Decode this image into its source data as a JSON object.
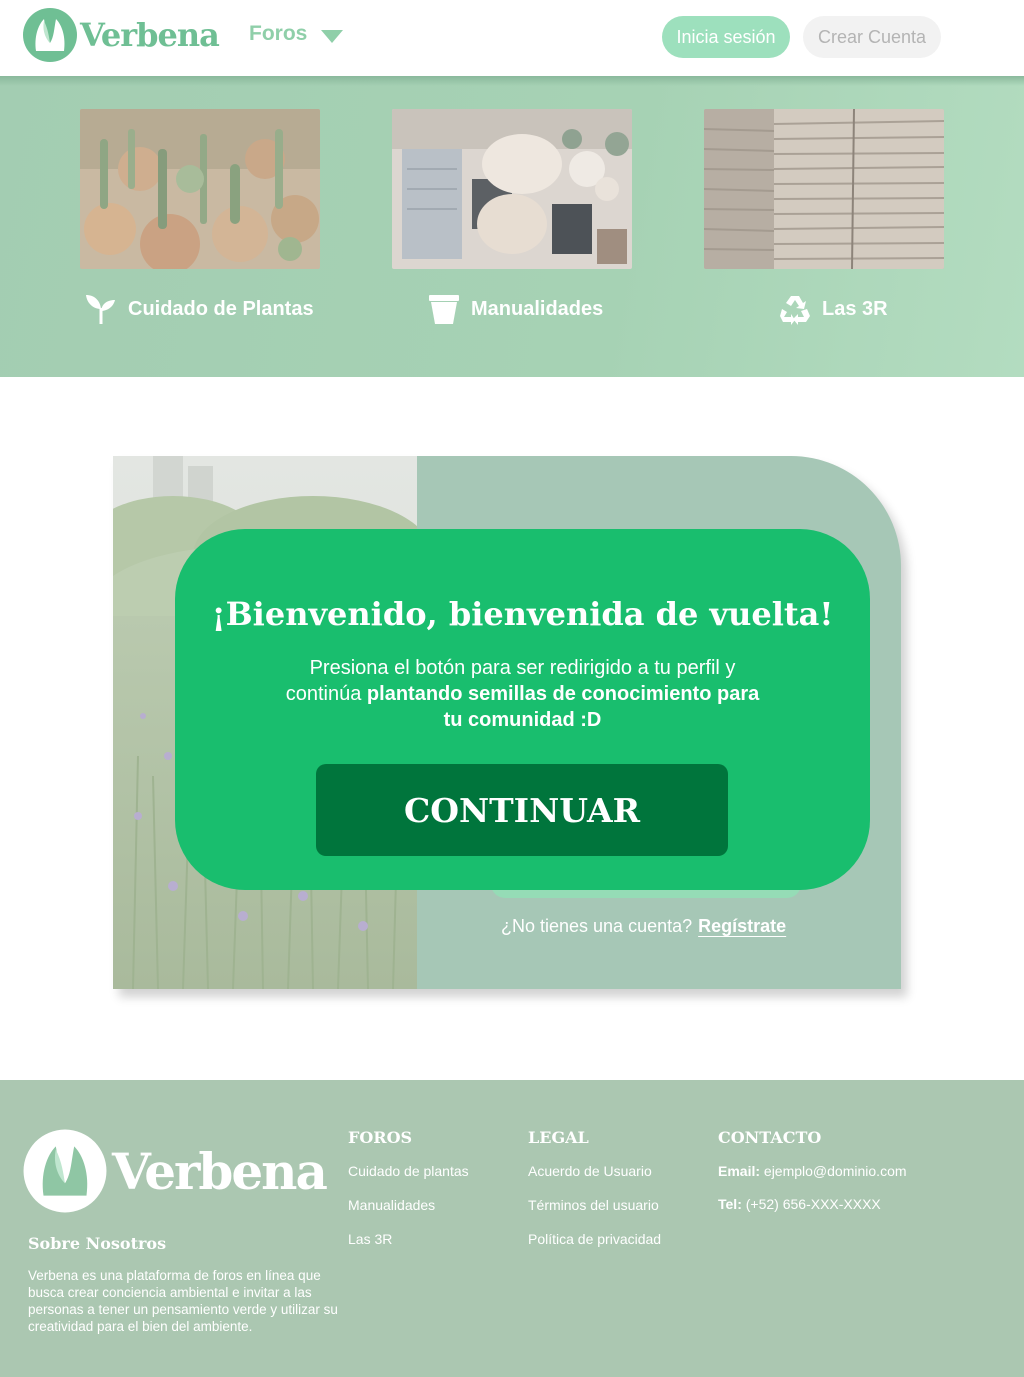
{
  "header": {
    "brand": "Verbena",
    "nav_foros": "Foros",
    "login_label": "Inicia sesión",
    "signup_label": "Crear Cuenta"
  },
  "categories": [
    {
      "label": "Cuidado de Plantas",
      "icon": "sprout-icon"
    },
    {
      "label": "Manualidades",
      "icon": "flowerpot-icon"
    },
    {
      "label": "Las 3R",
      "icon": "recycle-icon"
    }
  ],
  "login_card": {
    "no_account_text": "¿No tienes una cuenta?",
    "register_link": "Regístrate"
  },
  "modal": {
    "title": "¡Bienvenido, bienvenida de vuelta!",
    "text_plain": "Presiona el botón para ser redirigido a tu perfil y continúa",
    "text_bold": "plantando semillas de conocimiento para tu comunidad :D",
    "continue_label": "CONTINUAR"
  },
  "footer": {
    "brand": "Verbena",
    "about_title": "Sobre Nosotros",
    "about_text": "Verbena es una plataforma de foros en línea que busca crear conciencia ambiental e invitar a las personas a tener un pensamiento verde y utilizar su creatividad para el bien del ambiente.",
    "foros": {
      "title": "FOROS",
      "links": [
        "Cuidado de plantas",
        "Manualidades",
        "Las 3R"
      ]
    },
    "legal": {
      "title": "LEGAL",
      "links": [
        "Acuerdo de Usuario",
        "Términos del usuario",
        "Política de privacidad"
      ]
    },
    "contacto": {
      "title": "CONTACTO",
      "email_label": "Email:",
      "email_value": "ejemplo@dominio.com",
      "tel_label": "Tel:",
      "tel_value": "(+52) 656-XXX-XXXX"
    }
  },
  "colors": {
    "brand_green": "#6fbf94",
    "modal_green": "#19be6e",
    "continue_dark": "#00753c",
    "footer_bg": "#abc7b1",
    "card_bg": "#a6c7b6"
  }
}
